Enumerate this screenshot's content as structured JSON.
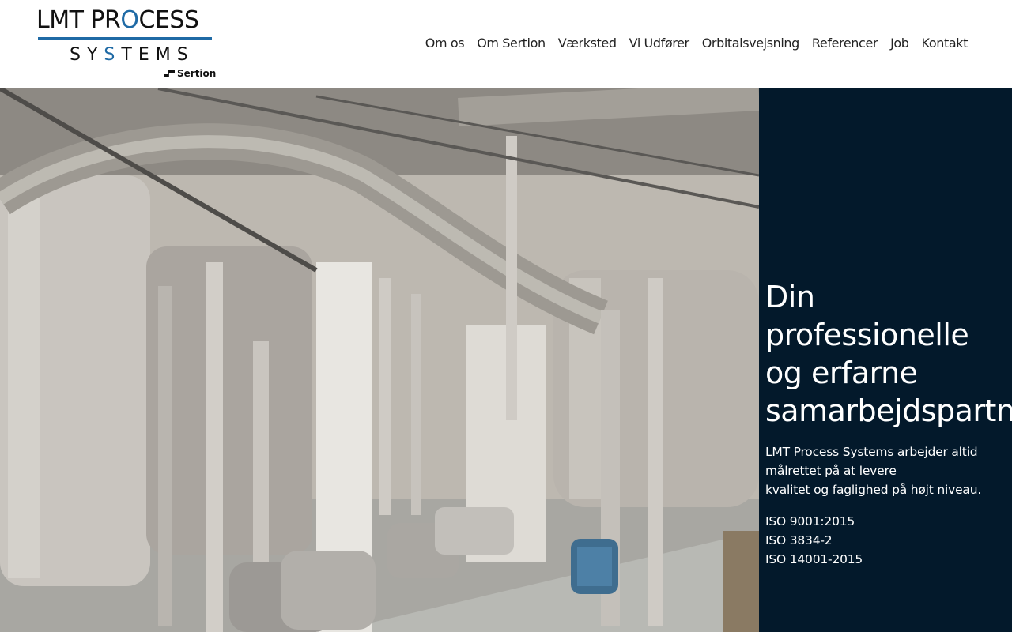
{
  "logo": {
    "line1_a": "LMT PR",
    "line1_o": "O",
    "line1_b": "CESS",
    "line2_a": "SY",
    "line2_s": "S",
    "line2_b": "TEMS",
    "sub": "Sertion",
    "accent_color": "#1f6aa5"
  },
  "nav": {
    "items": [
      "Om os",
      "Om Sertion",
      "Værksted",
      "Vi Udfører",
      "Orbitalsvejsning",
      "Referencer",
      "Job",
      "Kontakt"
    ]
  },
  "hero": {
    "image_desc": "industrial-process-plant-photo",
    "panel_color": "#03192b",
    "title_lines": [
      "Din",
      "professionelle",
      "og erfarne",
      "samarbejdspartner"
    ],
    "body_lines": [
      "LMT Process Systems arbejder altid",
      "målrettet på at levere",
      "kvalitet og faglighed på højt niveau."
    ],
    "certs": [
      "ISO 9001:2015",
      "ISO 3834-2",
      "ISO 14001-2015"
    ]
  }
}
